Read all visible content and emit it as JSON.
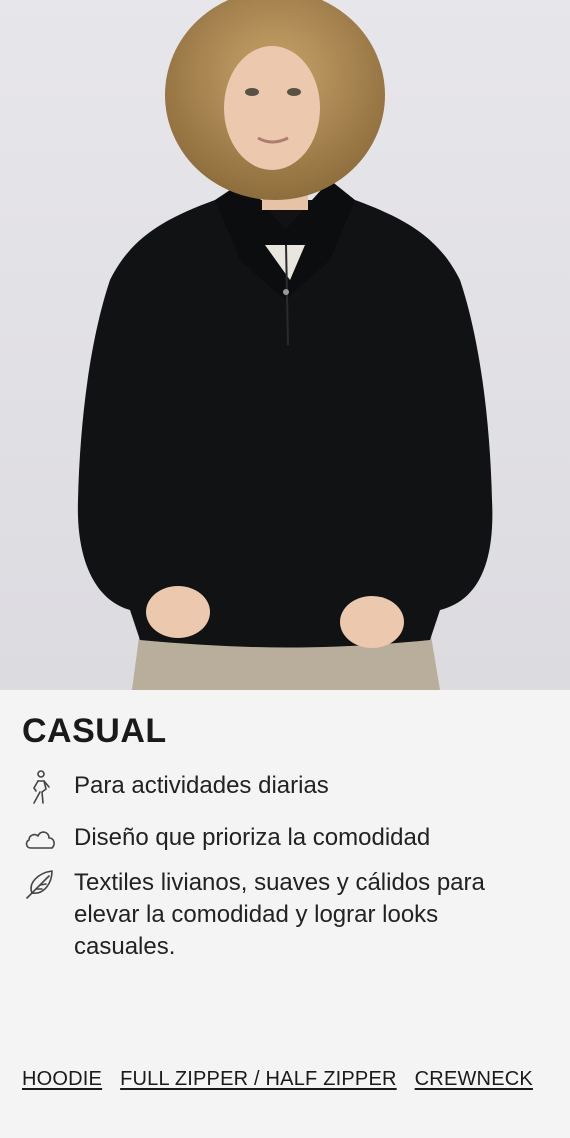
{
  "hero": {
    "image_alt": ""
  },
  "category": {
    "title": "CASUAL"
  },
  "features": [
    {
      "icon": "walking-person-icon",
      "text": "Para actividades diarias"
    },
    {
      "icon": "cloud-icon",
      "text": "Diseño que prioriza la comodidad"
    },
    {
      "icon": "feather-icon",
      "text": "Textiles livianos, suaves y cálidos para elevar la comodidad y lograr looks casuales."
    }
  ],
  "links": [
    {
      "label": "HOODIE"
    },
    {
      "label": "FULL ZIPPER / HALF ZIPPER"
    },
    {
      "label": "CREWNECK"
    }
  ]
}
